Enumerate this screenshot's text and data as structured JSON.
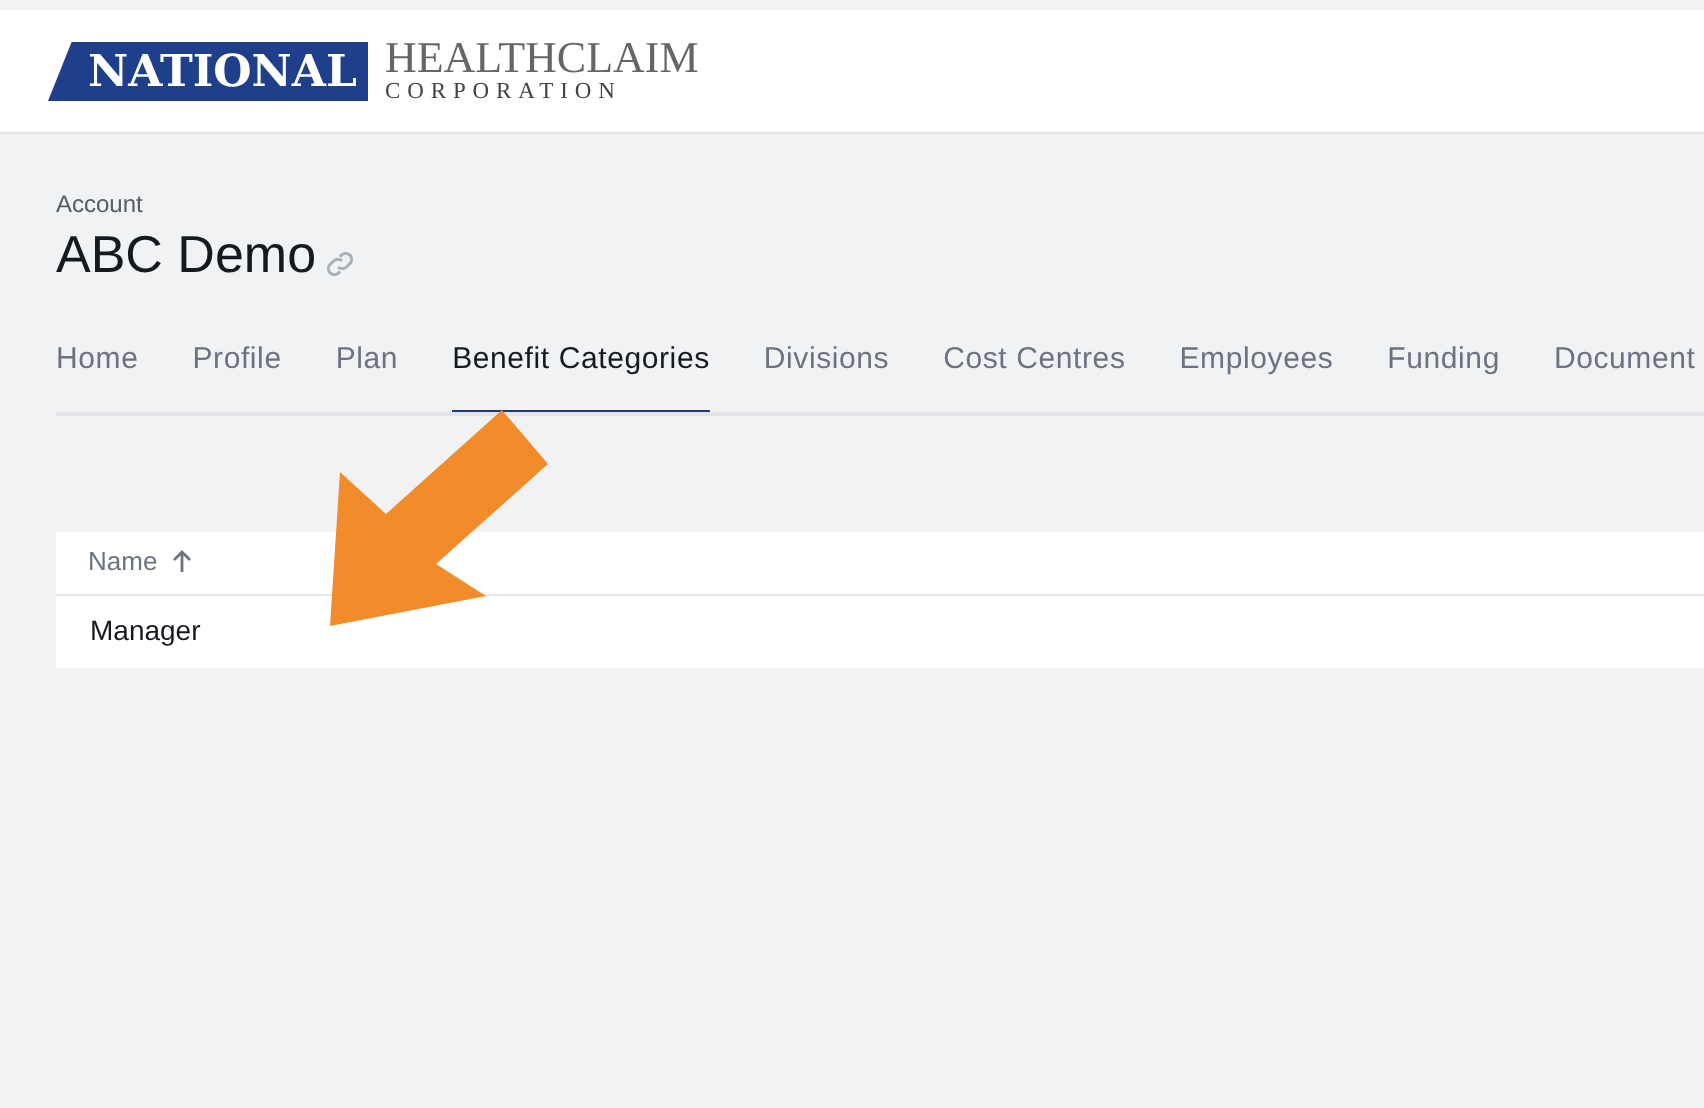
{
  "logo": {
    "badge": "NATIONAL",
    "name": "HEALTHCLAIM",
    "subtitle": "CORPORATION"
  },
  "account": {
    "label": "Account",
    "title": "ABC Demo"
  },
  "tabs": [
    {
      "label": "Home",
      "selected": false
    },
    {
      "label": "Profile",
      "selected": false
    },
    {
      "label": "Plan",
      "selected": false
    },
    {
      "label": "Benefit Categories",
      "selected": true
    },
    {
      "label": "Divisions",
      "selected": false
    },
    {
      "label": "Cost Centres",
      "selected": false
    },
    {
      "label": "Employees",
      "selected": false
    },
    {
      "label": "Funding",
      "selected": false
    },
    {
      "label": "Document",
      "selected": false
    }
  ],
  "table": {
    "columns": [
      {
        "label": "Name",
        "sorted": true
      }
    ],
    "rows": [
      [
        "Manager"
      ]
    ]
  }
}
